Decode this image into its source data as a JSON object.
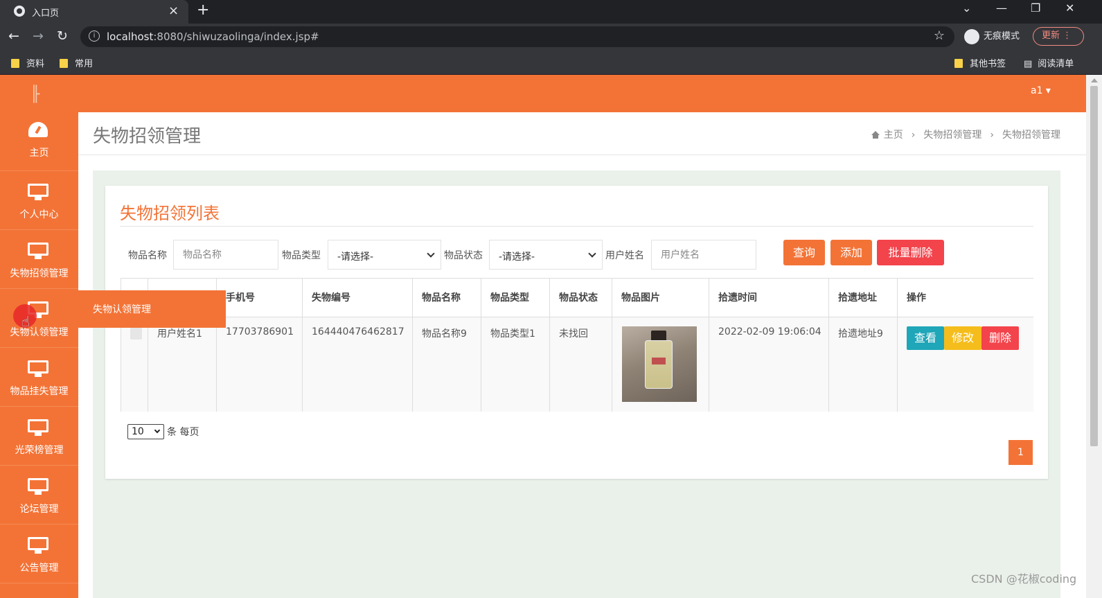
{
  "browser": {
    "tab_title": "入口页",
    "tab_close": "×",
    "new_tab": "+",
    "url_host": "localhost",
    "url_rest": ":8080/shiwuzaolinga/index.jsp#",
    "incognito_label": "无痕模式",
    "update_label": "更新",
    "bookmarks": [
      "资料",
      "常用"
    ],
    "other_bookmarks": "其他书签",
    "reading_list": "阅读清单"
  },
  "app": {
    "user": "a1 ▾",
    "sidebar": [
      {
        "label": "主页",
        "icon": "dashboard-icon"
      },
      {
        "label": "个人中心",
        "icon": "monitor-icon"
      },
      {
        "label": "失物招领管理",
        "icon": "monitor-icon"
      },
      {
        "label": "失物认领管理",
        "icon": "monitor-icon"
      },
      {
        "label": "物品挂失管理",
        "icon": "monitor-icon"
      },
      {
        "label": "光荣榜管理",
        "icon": "monitor-icon"
      },
      {
        "label": "论坛管理",
        "icon": "monitor-icon"
      },
      {
        "label": "公告管理",
        "icon": "monitor-icon"
      }
    ],
    "flyout_label": "失物认领管理",
    "page_title": "失物招领管理",
    "breadcrumb": [
      "主页",
      "失物招领管理",
      "失物招领管理"
    ],
    "card_title": "失物招领列表",
    "filters": {
      "name_label": "物品名称",
      "name_placeholder": "物品名称",
      "type_label": "物品类型",
      "type_value": "-请选择-",
      "status_label": "物品状态",
      "status_value": "-请选择-",
      "user_label": "用户姓名",
      "user_placeholder": "用户姓名"
    },
    "buttons": {
      "query": "查询",
      "add": "添加",
      "batch_delete": "批量删除"
    },
    "table": {
      "headers": [
        "",
        "",
        "手机号",
        "失物编号",
        "物品名称",
        "物品类型",
        "物品状态",
        "物品图片",
        "拾遗时间",
        "拾遗地址",
        "操作"
      ],
      "rows": [
        {
          "user": "用户姓名1",
          "phone": "17703786901",
          "number": "164440476462817",
          "name": "物品名称9",
          "type": "物品类型1",
          "status": "未找回",
          "time": "2022-02-09 19:06:04",
          "address": "拾遗地址9"
        }
      ],
      "actions": {
        "view": "查看",
        "edit": "修改",
        "delete": "删除"
      }
    },
    "pagination": {
      "page_size": "10",
      "per_page_text": "条 每页",
      "current_page": "1"
    }
  },
  "watermark": "CSDN @花椒coding",
  "colors": {
    "accent": "#f37336",
    "danger": "#f3434b",
    "info": "#1fa6b8",
    "warning": "#f5bd1c"
  }
}
